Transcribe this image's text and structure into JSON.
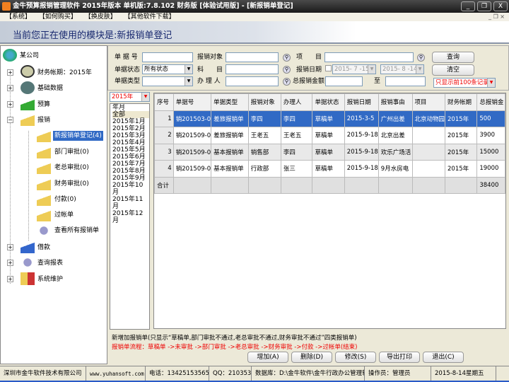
{
  "window": {
    "title": "金牛预算报销管理软件 2015年版本 单机版:7.8.102 财务版 [体验试用版] - [新报销单登记]",
    "min": "_",
    "max": "❐",
    "close": "X"
  },
  "menu": [
    "【系统】",
    "【如何购买】",
    "【换皮肤】",
    "【其他软件下载】"
  ],
  "mdi_controls": "_ ❐ ×",
  "banner": "当前您正在使用的模块是:新报销单登记",
  "tree": {
    "root": "某公司",
    "items": [
      {
        "label": "财务帐期：2015年",
        "expander": "+"
      },
      {
        "label": "基础数据",
        "expander": "+"
      },
      {
        "label": "预算",
        "expander": "+"
      },
      {
        "label": "报销",
        "expander": "−"
      },
      {
        "label": "借款",
        "expander": "+"
      },
      {
        "label": "查询报表",
        "expander": "+"
      },
      {
        "label": "系统维护",
        "expander": "+"
      }
    ],
    "children": [
      "新报销单登记(4)",
      "部门审批(0)",
      "老总审批(0)",
      "财务审批(0)",
      "付款(0)",
      "过帐单",
      "查看所有报销单"
    ]
  },
  "filter": {
    "bill_no": "单 据 号",
    "target": "报销对象",
    "project": "项　　目",
    "status": "单据状态",
    "status_value": "所有状态",
    "subject": "科　　目",
    "date": "报销日期",
    "date_from": "2015- 7 -15",
    "date_to": "2015- 8 -14",
    "type": "单据类型",
    "handler": "办 理 人",
    "amount": "总报销金额",
    "to": "至",
    "query": "查询",
    "clear": "清空",
    "limit": "只显示前100条记录"
  },
  "year_select": "2015年",
  "months": [
    "年月",
    "全部",
    "2015年1月",
    "2015年2月",
    "2015年3月",
    "2015年4月",
    "2015年5月",
    "2015年6月",
    "2015年7月",
    "2015年8月",
    "2015年9月",
    "2015年10月",
    "2015年11月",
    "2015年12月"
  ],
  "grid": {
    "columns": [
      "序号",
      "单据号",
      "单据类型",
      "报销对象",
      "办理人",
      "单据状态",
      "报销日期",
      "报销事由",
      "项目",
      "财务帐期",
      "总报销金"
    ],
    "rows": [
      [
        "1",
        "销201503-0",
        "差旅报销单",
        "李四",
        "李四",
        "草稿单",
        "2015-3-5",
        "广州出差",
        "北京动物园",
        "2015年",
        "500"
      ],
      [
        "2",
        "销201509-0",
        "差旅报销单",
        "王老五",
        "王老五",
        "草稿单",
        "2015-9-18",
        "北京出差",
        "",
        "2015年",
        "3900"
      ],
      [
        "3",
        "销201509-0",
        "基本报销单",
        "销售部",
        "李四",
        "草稿单",
        "2015-9-18",
        "欢乐广场活",
        "",
        "2015年",
        "15000"
      ],
      [
        "4",
        "销201509-0",
        "基本报销单",
        "行政部",
        "张三",
        "草稿单",
        "2015-9-18",
        "9月水房电",
        "",
        "2015年",
        "19000"
      ]
    ],
    "total_label": "合计",
    "total_value": "38400"
  },
  "info1": "新增加报销单(只显示“草稿单,部门审批不通过,老总审批不通过,财务审批不通过”四类报销单)",
  "info2": "报销单流程：草稿单 ->未审批 ->部门审批 ->老总审批 ->财务审批 ->付款 ->过帐单(结束)",
  "buttons": [
    "增加(A)",
    "删除(D)",
    "修改(S)",
    "导出打印",
    "退出(C)"
  ],
  "status": {
    "company": "深圳市金牛软件技术有限公司",
    "site": "www.yuhansoft.com",
    "phone": "电话：13425153565",
    "qq": "QQ：21035391",
    "db": "数据库：D:\\金牛软件\\金牛行政办公管理软件",
    "operator": "操作员：管理员",
    "date": "2015-8-14星期五"
  }
}
